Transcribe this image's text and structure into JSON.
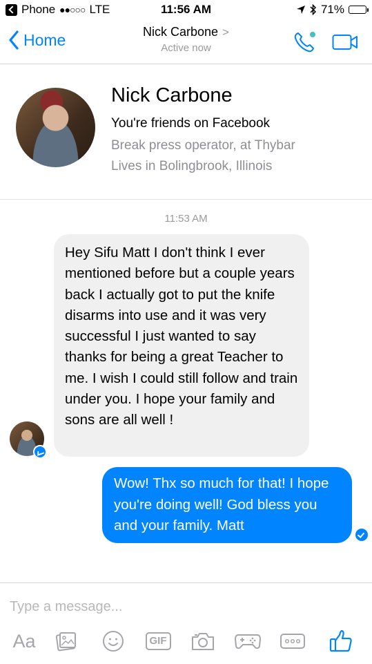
{
  "status_bar": {
    "back_app": "Phone",
    "signal": "●●○○○",
    "carrier": "LTE",
    "time": "11:56 AM",
    "battery": "71%",
    "battery_level": 0.71
  },
  "header": {
    "back_label": "Home",
    "title": "Nick Carbone",
    "subtitle": "Active now",
    "accent_color": "#0084ff",
    "online_color": "#44bec7"
  },
  "profile": {
    "name": "Nick Carbone",
    "friends_text": "You're friends on Facebook",
    "job": "Break press operator, at Thybar",
    "lives": "Lives in Bolingbrook, Illinois"
  },
  "conversation": {
    "timestamp": "11:53 AM",
    "incoming_message": "Hey Sifu Matt I don't think I ever mentioned before but a couple years back I actually got to put the knife disarms into use and it was very successful I just wanted to say thanks for being a great Teacher to me. I wish I could still follow and train under you. I hope your family and sons are all well !",
    "outgoing_message": "Wow!  Thx so much for that!  I hope you're doing well!  God bless you and your family.  Matt"
  },
  "composer": {
    "placeholder": "Type a message...",
    "text_label": "Aa",
    "gif_label": "GIF"
  },
  "icons": {
    "phone": "phone-icon",
    "video": "video-camera-icon",
    "photo": "image-icon",
    "emoji": "smiley-icon",
    "camera": "camera-icon",
    "game": "game-controller-icon",
    "more": "more-icon",
    "like": "thumbs-up-icon"
  }
}
